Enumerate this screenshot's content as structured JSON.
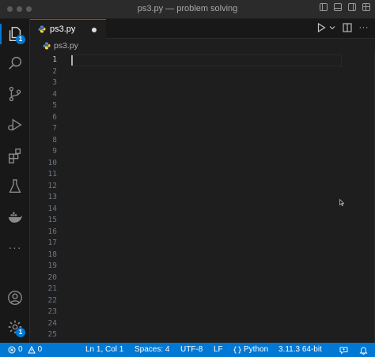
{
  "window": {
    "title": "ps3.py — problem solving"
  },
  "activity_bar": {
    "explorer_badge": "1",
    "settings_badge": "1",
    "more_label": "···"
  },
  "tabs": [
    {
      "label": "ps3.py",
      "dirty": true,
      "active": true
    }
  ],
  "breadcrumb": {
    "file": "ps3.py"
  },
  "editor": {
    "line_numbers": [
      "1",
      "2",
      "3",
      "4",
      "5",
      "6",
      "7",
      "8",
      "9",
      "10",
      "11",
      "12",
      "13",
      "14",
      "15",
      "16",
      "17",
      "18",
      "19",
      "20",
      "21",
      "22",
      "23",
      "24",
      "25"
    ],
    "active_line": "1"
  },
  "status_bar": {
    "errors": "0",
    "warnings": "0",
    "cursor_position": "Ln 1, Col 1",
    "indentation": "Spaces: 4",
    "encoding": "UTF-8",
    "line_ending": "LF",
    "language": "Python",
    "interpreter": "3.11.3 64-bit"
  },
  "colors": {
    "accent": "#0078d4",
    "editor_bg": "#1e1e1e",
    "sidebar_bg": "#181818"
  }
}
